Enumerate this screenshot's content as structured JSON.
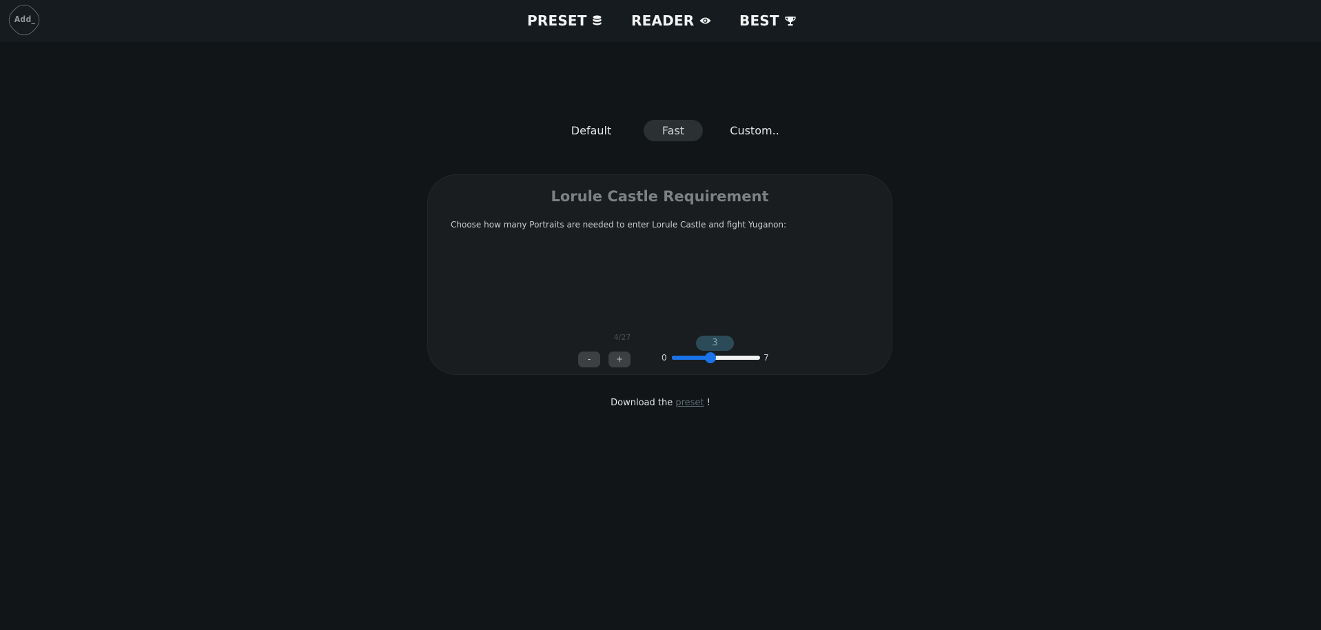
{
  "logo": {
    "text": "Add_"
  },
  "nav": [
    {
      "label": "PRESET",
      "icon": "database-icon"
    },
    {
      "label": "READER",
      "icon": "eye-icon"
    },
    {
      "label": "BEST",
      "icon": "trophy-icon"
    }
  ],
  "tabs": [
    {
      "label": "Default",
      "selected": false
    },
    {
      "label": "Fast",
      "selected": true
    },
    {
      "label": "Custom..",
      "selected": false
    }
  ],
  "card": {
    "title": "Lorule Castle Requirement",
    "description": "Choose how many Portraits are needed to enter Lorule Castle and fight Yuganon:",
    "counter": "4/27",
    "minus_label": "-",
    "plus_label": "+",
    "slider": {
      "min": 0,
      "max": 7,
      "value": 3,
      "min_label": "0",
      "max_label": "7",
      "value_label": "3"
    }
  },
  "footer": {
    "prefix": "Download the ",
    "link": "preset",
    "suffix": " !"
  },
  "colors": {
    "accent": "#1a73e8",
    "background": "#111517",
    "card": "#1a1d1f",
    "bubble": "#2c4b58"
  }
}
